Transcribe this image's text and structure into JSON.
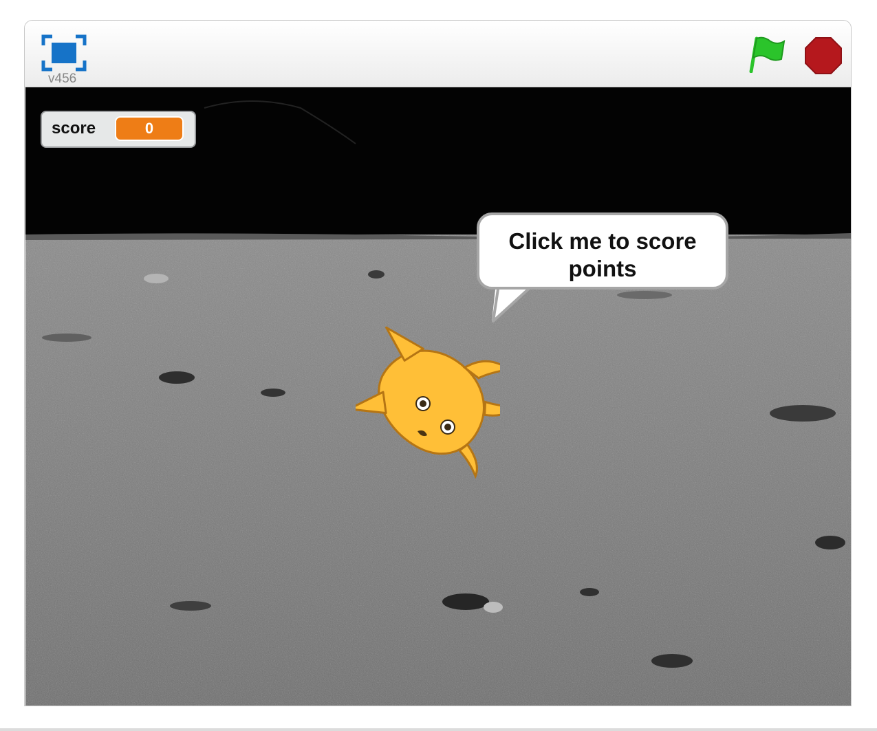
{
  "player": {
    "version": "v456",
    "icons": {
      "fullscreen": "fullscreen-icon",
      "green_flag": "green-flag-icon",
      "stop": "stop-sign-icon"
    },
    "colors": {
      "flag": "#2bc42b",
      "stop": "#b5181d",
      "fullscreen": "#1673c8"
    }
  },
  "stage": {
    "variable_monitor": {
      "label": "score",
      "value": "0",
      "color": "#ee7d16"
    },
    "speech_bubble": {
      "text": "Click me to score points"
    },
    "sprite": {
      "icon": "orange-cat-sprite",
      "color": "#ffbf37"
    }
  }
}
